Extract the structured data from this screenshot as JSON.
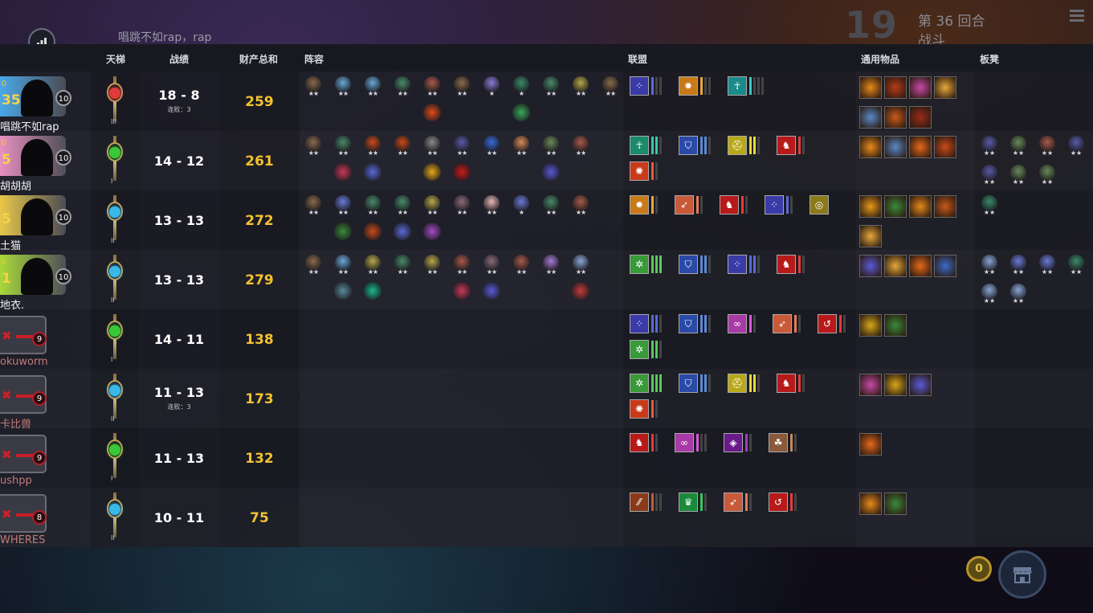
{
  "top": {
    "chat_message": "唱跳不如rap，rap",
    "round_number": "19",
    "round_label": "第 36 回合",
    "phase_label": "战斗"
  },
  "headers": {
    "ladder": "天梯",
    "record": "战绩",
    "networth": "财产总和",
    "lineup": "阵容",
    "alliances": "联盟",
    "items": "通用物品",
    "bench": "板凳"
  },
  "players": [
    {
      "name": "唱跳不如rap",
      "gold": "0",
      "hp": "35",
      "level": "10",
      "record": "18 - 8",
      "streak": "连败：3",
      "networth": "259",
      "ladder_rank": "III",
      "alive": true,
      "avatar_color": "#4aa8e8",
      "gem": "#e03a3a",
      "unit_colors": [
        "#8a6a4a",
        "#6aa8d8",
        "#6aa8d8",
        "#4a8a6a",
        "#a85a4a",
        "#8a6a4a",
        "#8a7ad8",
        "#3a8a6a",
        "#4a8a6a",
        "#b8a84a",
        "#8a6a4a"
      ],
      "unit_stars": [
        "★★",
        "★★",
        "★★",
        "★★",
        "★★",
        "★★",
        "★",
        "★",
        "★★",
        "★★",
        "★★"
      ],
      "unit_items": [
        {
          "slot": 4,
          "color": "#e04a1a"
        },
        {
          "slot": 7,
          "color": "#3aa85a"
        }
      ],
      "alliances": [
        {
          "color": "#3a3aa8",
          "glyph": "⁘",
          "pips": [
            "#5a6ad8",
            "#444",
            "#444"
          ]
        },
        {
          "color": "#c87a1a",
          "glyph": "✹",
          "pips": [
            "#e8a83a",
            "#444",
            "#444"
          ]
        },
        {
          "color": "#1a8a8a",
          "glyph": "☥",
          "pips": [
            "#3ac8c8",
            "#444",
            "#444",
            "#444"
          ]
        }
      ],
      "items": [
        "#e88a1a",
        "#b83a1a",
        "#c84aa8",
        "#e8a83a",
        "#5a8ac8",
        "#c85a1a",
        "#9a2a1a"
      ],
      "bench": []
    },
    {
      "name": "胡胡胡",
      "gold": "0",
      "hp": "5",
      "level": "10",
      "record": "14 - 12",
      "streak": "",
      "networth": "261",
      "ladder_rank": "I",
      "alive": true,
      "avatar_color": "#e890c0",
      "gem": "#3ac83a",
      "unit_colors": [
        "#8a6a4a",
        "#4a8a6a",
        "#c84a1a",
        "#c84a1a",
        "#8a8a8a",
        "#5a5aa8",
        "#3a6ad8",
        "#d88a5a",
        "#6a8a5a",
        "#a85a4a"
      ],
      "unit_stars": [
        "★★",
        "★★",
        "★★",
        "★★",
        "★★",
        "★★",
        "★★",
        "★★",
        "★★",
        "★★"
      ],
      "unit_items": [
        {
          "slot": 1,
          "color": "#c83a5a"
        },
        {
          "slot": 2,
          "color": "#5a6ad8"
        },
        {
          "slot": 4,
          "color": "#e8a81a"
        },
        {
          "slot": 5,
          "color": "#c81a1a"
        },
        {
          "slot": 8,
          "color": "#5a5ad8"
        }
      ],
      "alliances": [
        {
          "color": "#1a8a6a",
          "glyph": "☥",
          "pips": [
            "#3ac8a8",
            "#3ac8a8",
            "#444"
          ]
        },
        {
          "color": "#2a4aa8",
          "glyph": "⛉",
          "pips": [
            "#5a8ad8",
            "#5a8ad8",
            "#444"
          ]
        },
        {
          "color": "#b8a81a",
          "glyph": "⛑",
          "pips": [
            "#e8d83a",
            "#e8d83a",
            "#444"
          ]
        },
        {
          "color": "#b81a1a",
          "glyph": "♞",
          "pips": [
            "#e83a3a",
            "#444"
          ]
        },
        {
          "color": "#c83a1a",
          "glyph": "✺",
          "pips": [
            "#e85a3a",
            "#444"
          ]
        }
      ],
      "items": [
        "#e88a1a",
        "#5a8ac8",
        "#e8681a",
        "#c84a1a"
      ],
      "bench": [
        "#5a5aa8",
        "#6a8a5a",
        "#a85a4a",
        "#5a5aa8",
        "#5a5aa8",
        "#6a8a5a",
        "#6a8a5a"
      ]
    },
    {
      "name": "土猫",
      "gold": "0",
      "hp": "5",
      "level": "10",
      "record": "13 - 13",
      "streak": "",
      "networth": "272",
      "ladder_rank": "II",
      "alive": true,
      "avatar_color": "#e8c84a",
      "gem": "#3ab8e8",
      "unit_colors": [
        "#8a6a4a",
        "#6a7ad8",
        "#4a8a6a",
        "#4a8a6a",
        "#b8a84a",
        "#8a6a7a",
        "#e8b8b8",
        "#6a7ad8",
        "#4a8a6a",
        "#a85a4a"
      ],
      "unit_stars": [
        "★★",
        "★★",
        "★★",
        "★★",
        "★★",
        "★★",
        "★★",
        "★",
        "★★",
        "★★"
      ],
      "unit_items": [
        {
          "slot": 1,
          "color": "#3a8a3a"
        },
        {
          "slot": 2,
          "color": "#c84a1a"
        },
        {
          "slot": 3,
          "color": "#5a6ad8"
        },
        {
          "slot": 4,
          "color": "#a84ac8"
        }
      ],
      "alliances": [
        {
          "color": "#c87a1a",
          "glyph": "✹",
          "pips": [
            "#e8a83a",
            "#444"
          ]
        },
        {
          "color": "#c85a3a",
          "glyph": "➶",
          "pips": [
            "#e87a5a",
            "#444"
          ]
        },
        {
          "color": "#b81a1a",
          "glyph": "♞",
          "pips": [
            "#e83a3a",
            "#444"
          ]
        },
        {
          "color": "#3a3aa8",
          "glyph": "⁘",
          "pips": [
            "#5a6ad8",
            "#444"
          ]
        },
        {
          "color": "#8a7a1a",
          "glyph": "◎",
          "pips": []
        }
      ],
      "items": [
        "#e89a1a",
        "#3a8a3a",
        "#e88a1a",
        "#c85a1a",
        "#e8a83a"
      ],
      "bench": [
        "#3a8a6a"
      ]
    },
    {
      "name": "地衣.",
      "gold": "0",
      "hp": "1",
      "level": "10",
      "record": "13 - 13",
      "streak": "",
      "networth": "279",
      "ladder_rank": "II",
      "alive": true,
      "avatar_color": "#a8d83a",
      "gem": "#3ab8e8",
      "unit_colors": [
        "#8a6a4a",
        "#6aa8d8",
        "#b8a84a",
        "#4a8a6a",
        "#b8a84a",
        "#a85a4a",
        "#8a6a7a",
        "#a85a4a",
        "#a87ad8",
        "#8aa8d8"
      ],
      "unit_stars": [
        "★★",
        "★★",
        "★★",
        "★★",
        "★★",
        "★★",
        "★★",
        "★★",
        "★★",
        "★★"
      ],
      "unit_items": [
        {
          "slot": 1,
          "color": "#5a8a9a"
        },
        {
          "slot": 2,
          "color": "#1ab88a"
        },
        {
          "slot": 5,
          "color": "#c83a5a"
        },
        {
          "slot": 6,
          "color": "#5a5ad8"
        },
        {
          "slot": 9,
          "color": "#c83a3a"
        }
      ],
      "alliances": [
        {
          "color": "#3a9a3a",
          "glyph": "✲",
          "pips": [
            "#5ac85a",
            "#5ac85a",
            "#5ac85a"
          ]
        },
        {
          "color": "#2a4aa8",
          "glyph": "⛉",
          "pips": [
            "#5a8ad8",
            "#5a8ad8",
            "#444"
          ]
        },
        {
          "color": "#3a3aa8",
          "glyph": "⁘",
          "pips": [
            "#5a6ad8",
            "#5a6ad8",
            "#444"
          ]
        },
        {
          "color": "#b81a1a",
          "glyph": "♞",
          "pips": [
            "#e83a3a",
            "#444"
          ]
        }
      ],
      "items": [
        "#5a5ad8",
        "#e8a83a",
        "#e8681a",
        "#3a6ac8"
      ],
      "bench": [
        "#8aa8d8",
        "#6a7ad8",
        "#6a7ad8",
        "#3a8a6a",
        "#8aa8d8",
        "#8aa8d8"
      ]
    },
    {
      "name": "okuworm",
      "gold": "",
      "hp": "",
      "level": "9",
      "record": "14 - 11",
      "streak": "",
      "networth": "138",
      "ladder_rank": "I",
      "alive": false,
      "avatar_color": "#3a3a44",
      "gem": "#3ac83a",
      "unit_colors": [],
      "unit_stars": [],
      "unit_items": [],
      "alliances": [
        {
          "color": "#3a3aa8",
          "glyph": "⁘",
          "pips": [
            "#5a6ad8",
            "#5a6ad8",
            "#444"
          ]
        },
        {
          "color": "#2a4aa8",
          "glyph": "⛉",
          "pips": [
            "#5a8ad8",
            "#5a8ad8",
            "#444"
          ]
        },
        {
          "color": "#a83aa8",
          "glyph": "∞",
          "pips": [
            "#d85ad8",
            "#444"
          ]
        },
        {
          "color": "#c85a3a",
          "glyph": "➶",
          "pips": [
            "#e87a5a",
            "#444"
          ]
        },
        {
          "color": "#b81a1a",
          "glyph": "↺",
          "pips": [
            "#e83a3a",
            "#444"
          ]
        },
        {
          "color": "#3a9a3a",
          "glyph": "✲",
          "pips": [
            "#5ac85a",
            "#5ac85a",
            "#444"
          ]
        }
      ],
      "items": [
        "#d8a81a",
        "#3a8a3a"
      ],
      "bench": []
    },
    {
      "name": "卡比兽",
      "gold": "",
      "hp": "",
      "level": "9",
      "record": "11 - 13",
      "streak": "连败：3",
      "networth": "173",
      "ladder_rank": "II",
      "alive": false,
      "avatar_color": "#3a3a44",
      "gem": "#3ab8e8",
      "unit_colors": [],
      "unit_stars": [],
      "unit_items": [],
      "alliances": [
        {
          "color": "#3a9a3a",
          "glyph": "✲",
          "pips": [
            "#5ac85a",
            "#5ac85a",
            "#5ac85a"
          ]
        },
        {
          "color": "#2a4aa8",
          "glyph": "⛉",
          "pips": [
            "#5a8ad8",
            "#5a8ad8",
            "#444"
          ]
        },
        {
          "color": "#b8a81a",
          "glyph": "⛑",
          "pips": [
            "#e8d83a",
            "#e8d83a",
            "#444"
          ]
        },
        {
          "color": "#b81a1a",
          "glyph": "♞",
          "pips": [
            "#e83a3a",
            "#444"
          ]
        },
        {
          "color": "#c83a1a",
          "glyph": "✺",
          "pips": [
            "#e85a3a",
            "#444"
          ]
        }
      ],
      "items": [
        "#c84aa8",
        "#d8a81a",
        "#5a5ad8"
      ],
      "bench": []
    },
    {
      "name": "ushpp",
      "gold": "",
      "hp": "",
      "level": "9",
      "record": "11 - 13",
      "streak": "",
      "networth": "132",
      "ladder_rank": "I",
      "alive": false,
      "avatar_color": "#3a3a44",
      "gem": "#3ac83a",
      "unit_colors": [],
      "unit_stars": [],
      "unit_items": [],
      "alliances": [
        {
          "color": "#b81a1a",
          "glyph": "♞",
          "pips": [
            "#e83a3a",
            "#444"
          ]
        },
        {
          "color": "#a83aa8",
          "glyph": "∞",
          "pips": [
            "#d85ad8",
            "#444",
            "#444"
          ]
        },
        {
          "color": "#6a1a8a",
          "glyph": "◈",
          "pips": [
            "#a83ac8",
            "#444"
          ]
        },
        {
          "color": "#8a5a3a",
          "glyph": "☘",
          "pips": [
            "#c88a5a",
            "#444"
          ]
        }
      ],
      "items": [
        "#e8681a"
      ],
      "bench": []
    },
    {
      "name": "WHERES",
      "gold": "",
      "hp": "",
      "level": "8",
      "record": "10 - 11",
      "streak": "",
      "networth": "75",
      "ladder_rank": "II",
      "alive": false,
      "avatar_color": "#3a3a44",
      "gem": "#3ab8e8",
      "unit_colors": [],
      "unit_stars": [],
      "unit_items": [],
      "alliances": [
        {
          "color": "#8a3a1a",
          "glyph": "⁄⁄",
          "pips": [
            "#c85a3a",
            "#444",
            "#444"
          ]
        },
        {
          "color": "#1a8a3a",
          "glyph": "♛",
          "pips": [
            "#3ac85a",
            "#444"
          ]
        },
        {
          "color": "#c85a3a",
          "glyph": "➶",
          "pips": [
            "#e87a5a",
            "#444"
          ]
        },
        {
          "color": "#b81a1a",
          "glyph": "↺",
          "pips": [
            "#e83a3a",
            "#444"
          ]
        }
      ],
      "items": [
        "#e88a1a",
        "#3a8a3a"
      ],
      "bench": []
    }
  ],
  "shop": {
    "gold": "0"
  }
}
